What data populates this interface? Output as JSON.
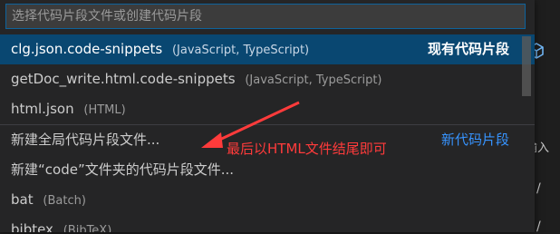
{
  "search": {
    "placeholder": "选择代码片段文件或创建代码片段"
  },
  "items": [
    {
      "label": "clg.json.code-snippets",
      "description": "(JavaScript, TypeScript)",
      "right_label": "现有代码片段"
    },
    {
      "label": "getDoc_write.html.code-snippets",
      "description": "(JavaScript, TypeScript)"
    },
    {
      "label": "html.json",
      "description": "(HTML)"
    },
    {
      "label": "新建全局代码片段文件...",
      "right_label": "新代码片段"
    },
    {
      "label": "新建“code”文件夹的代码片段文件..."
    },
    {
      "label": "bat",
      "description": "(Batch)"
    },
    {
      "label": "bibtex",
      "description": "(BibTeX)"
    }
  ],
  "annotation": {
    "text": "最后以HTML文件结尾即可",
    "color": "#ff3b3b"
  },
  "editor": {
    "fragment": "输入",
    "slash1": "/",
    "slash2": "/"
  },
  "colors": {
    "selected_bg": "#094771",
    "accent_blue": "#3794ff",
    "focus_border": "#0e639c"
  }
}
